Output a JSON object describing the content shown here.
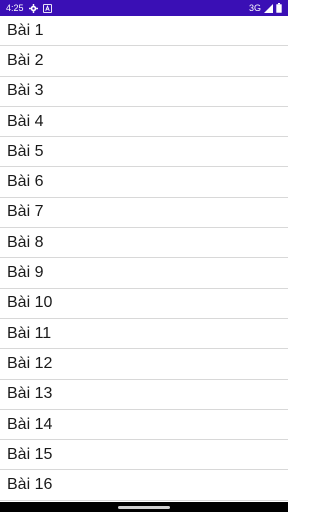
{
  "status_bar": {
    "time": "4:25",
    "network": "3G",
    "icons": [
      "gear-icon",
      "a-badge-icon",
      "signal-icon",
      "battery-icon"
    ],
    "background_color": "#3a0fb5"
  },
  "list": {
    "items": [
      {
        "label": "Bài 1"
      },
      {
        "label": "Bài 2"
      },
      {
        "label": "Bài 3"
      },
      {
        "label": "Bài 4"
      },
      {
        "label": "Bài 5"
      },
      {
        "label": "Bài 6"
      },
      {
        "label": "Bài 7"
      },
      {
        "label": "Bài 8"
      },
      {
        "label": "Bài 9"
      },
      {
        "label": "Bài 10"
      },
      {
        "label": "Bài 11"
      },
      {
        "label": "Bài 12"
      },
      {
        "label": "Bài 13"
      },
      {
        "label": "Bài 14"
      },
      {
        "label": "Bài 15"
      },
      {
        "label": "Bài 16"
      }
    ]
  }
}
